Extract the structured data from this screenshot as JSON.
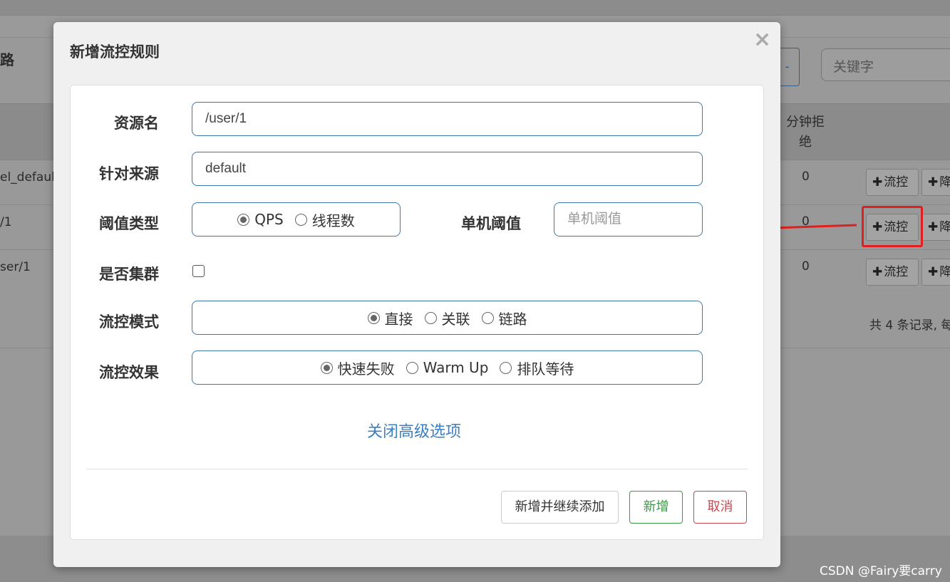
{
  "background": {
    "crumb": "路",
    "outline_button_glyph": "-",
    "search_placeholder": "关键字",
    "column_header": "分钟拒绝",
    "rows": [
      {
        "resource": "el_defaul",
        "value": "0",
        "flow_btn": "流控",
        "degrade_btn": "降"
      },
      {
        "resource": "/1",
        "value": "0",
        "flow_btn": "流控",
        "degrade_btn": "降"
      },
      {
        "resource": "ser/1",
        "value": "0",
        "flow_btn": "流控",
        "degrade_btn": "降"
      }
    ],
    "footer_text": "共 4 条记录, 每"
  },
  "modal": {
    "title": "新增流控规则",
    "close_glyph": "×",
    "fields": {
      "resource_label": "资源名",
      "resource_value": "/user/1",
      "origin_label": "针对来源",
      "origin_value": "default",
      "threshold_type_label": "阈值类型",
      "threshold_type_options": [
        "QPS",
        "线程数"
      ],
      "threshold_type_selected": "QPS",
      "single_threshold_label": "单机阈值",
      "single_threshold_placeholder": "单机阈值",
      "cluster_label": "是否集群",
      "cluster_checked": false,
      "mode_label": "流控模式",
      "mode_options": [
        "直接",
        "关联",
        "链路"
      ],
      "mode_selected": "直接",
      "effect_label": "流控效果",
      "effect_options": [
        "快速失败",
        "Warm Up",
        "排队等待"
      ],
      "effect_selected": "快速失败"
    },
    "advanced_link": "关闭高级选项",
    "buttons": {
      "add_continue": "新增并继续添加",
      "add": "新增",
      "cancel": "取消"
    }
  },
  "watermark": "CSDN @Fairy要carry",
  "colors": {
    "accent_blue": "#3e77a8",
    "link_blue": "#3b7fc4",
    "success_green": "#3c9a44",
    "danger_red": "#c9474f",
    "annotation_red": "#e02020"
  }
}
